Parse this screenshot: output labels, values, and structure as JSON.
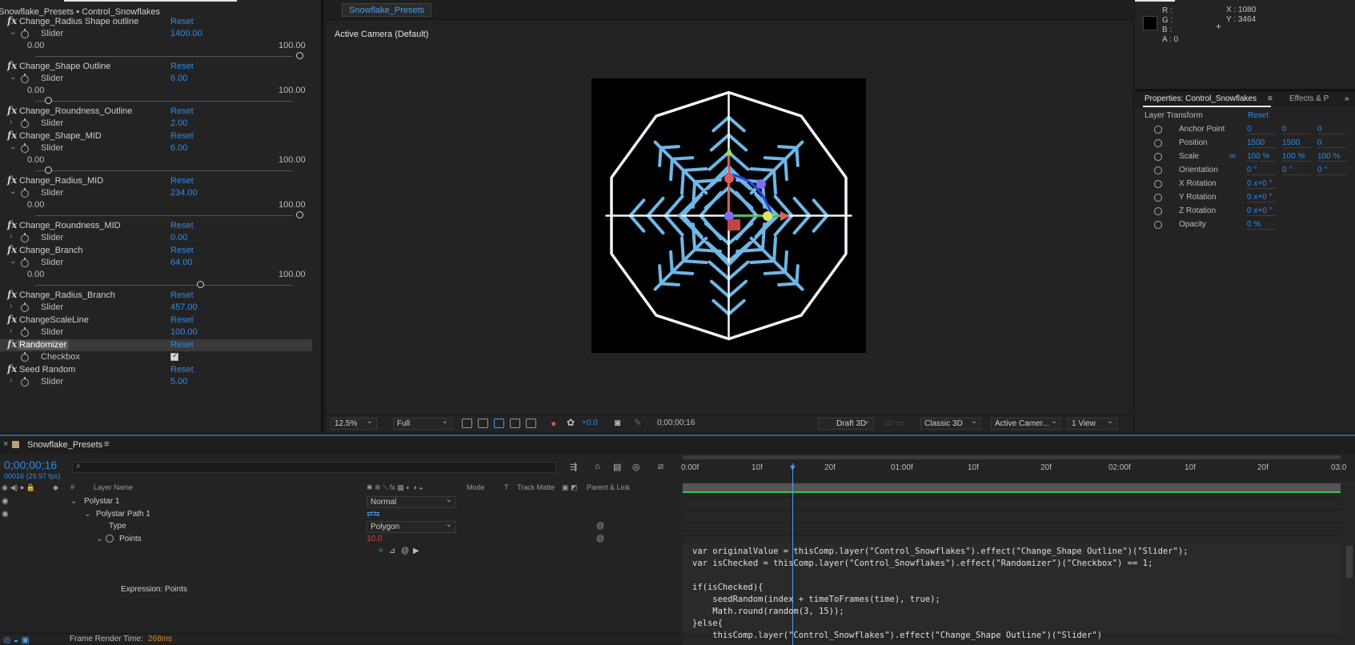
{
  "effect_panel": {
    "title": "Snowflake_Presets • Control_Snowflakes",
    "reset_label": "Reset",
    "slider_label": "Slider",
    "checkbox_label": "Checkbox",
    "range_min": "0.00",
    "range_max": "100.00",
    "effects": [
      {
        "name": "Change_Radius Shape outline",
        "value": "1400.00",
        "slider_pos": 1.0
      },
      {
        "name": "Change_Shape Outline",
        "value": "6.00",
        "slider_pos": 0.06
      },
      {
        "name": "Change_Roundness_Outline",
        "value": "2.00"
      },
      {
        "name": "Change_Shape_MID",
        "value": "6.00",
        "slider_pos": 0.06
      },
      {
        "name": "Change_Radius_MID",
        "value": "234.00",
        "slider_pos": 1.0
      },
      {
        "name": "Change_Roundness_MID",
        "value": "0.00"
      },
      {
        "name": "Change_Branch",
        "value": "64.00",
        "slider_pos": 0.64
      },
      {
        "name": "Change_Radius_Branch",
        "value": "457.00"
      },
      {
        "name": "ChangeScaleLine",
        "value": "100.00"
      },
      {
        "name": "Randomizer",
        "checked": true
      },
      {
        "name": "Seed Random",
        "value": "5.00"
      }
    ]
  },
  "viewer": {
    "tab": "Snowflake_Presets",
    "camera_label": "Active Camera (Default)",
    "zoom": "12.5%",
    "resolution": "Full",
    "exposure": "+0.0",
    "timecode": "0;00;00;16",
    "draft_3d": "Draft 3D",
    "renderer": "Classic 3D",
    "camera": "Active Camer...",
    "views": "1 View"
  },
  "info": {
    "r": "R :",
    "g": "G :",
    "b": "B :",
    "a": "A :  0",
    "x": "X : 1080",
    "y": "Y : 3464"
  },
  "properties": {
    "tab_active": "Properties: Control_Snowflakes",
    "tab_other": "Effects & P",
    "section": "Layer Transform",
    "reset": "Reset",
    "rows": [
      {
        "name": "Anchor Point",
        "v1": "0",
        "v2": "0",
        "v3": "0"
      },
      {
        "name": "Position",
        "v1": "1500",
        "v2": "1500",
        "v3": "0"
      },
      {
        "name": "Scale",
        "v1": "100 %",
        "v2": "100 %",
        "v3": "100 %"
      },
      {
        "name": "Orientation",
        "v1": "0 °",
        "v2": "0 °",
        "v3": "0 °"
      },
      {
        "name": "X Rotation",
        "v1": "0 x+0 °"
      },
      {
        "name": "Y Rotation",
        "v1": "0 x+0 °"
      },
      {
        "name": "Z Rotation",
        "v1": "0 x+0 °"
      },
      {
        "name": "Opacity",
        "v1": "0 %"
      }
    ]
  },
  "timeline": {
    "tab": "Snowflake_Presets",
    "timecode": "0;00;00;16",
    "fps": "00016 (29.97 fps)",
    "columns": {
      "layer_name": "Layer Name",
      "mode": "Mode",
      "t": "T",
      "track_matte": "Track Matte",
      "parent": "Parent & Link"
    },
    "rows": [
      {
        "name": "Polystar 1",
        "value": "Normal"
      },
      {
        "name": "Polystar Path 1"
      },
      {
        "name": "Type",
        "value": "Polygon"
      },
      {
        "name": "Points",
        "value": "10.0"
      }
    ],
    "expression_label": "Expression: Points",
    "ruler": [
      "0:00f",
      "10f",
      "20f",
      "01:00f",
      "10f",
      "20f",
      "02:00f",
      "10f",
      "20f",
      "03:0"
    ],
    "code": [
      "var originalValue = thisComp.layer(\"Control_Snowflakes\").effect(\"Change_Shape Outline\")(\"Slider\");",
      "var isChecked = thisComp.layer(\"Control_Snowflakes\").effect(\"Randomizer\")(\"Checkbox\") == 1;",
      "",
      "if(isChecked){",
      "    seedRandom(index + timeToFrames(time), true);",
      "    Math.round(random(3, 15));",
      "}else{",
      "    thisComp.layer(\"Control_Snowflakes\").effect(\"Change_Shape Outline\")(\"Slider\")"
    ],
    "render_time_label": "Frame Render Time:",
    "render_time_value": "268ms"
  }
}
